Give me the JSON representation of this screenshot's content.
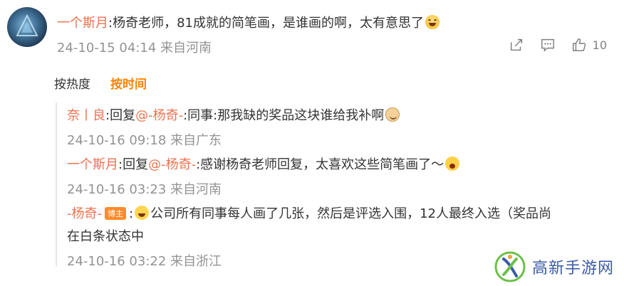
{
  "comment": {
    "username": "一个斯月",
    "text": ":杨奇老师，81成就的简笔画，是谁画的啊，太有意思了",
    "time": "24-10-15 04:14",
    "location": "来自河南",
    "like_count": "10",
    "icons": [
      "share-icon",
      "reply-icon",
      "like-icon"
    ]
  },
  "sort": {
    "hot": "按热度",
    "time": "按时间"
  },
  "replies": [
    {
      "username": "奈丨良",
      "reply_word": ":回复",
      "mention": "@-杨奇-",
      "text": ":同事:那我缺的奖品这块谁给我补啊",
      "time": "24-10-16 09:18",
      "location": "来自广东"
    },
    {
      "username": "一个斯月",
      "reply_word": ":回复",
      "mention": "@-杨奇-",
      "text": ":感谢杨奇老师回复，太喜欢这些简笔画了～",
      "time": "24-10-16 03:23",
      "location": "来自河南"
    },
    {
      "username": "-杨奇-",
      "badge": "博主",
      "text_line1": "公司所有同事每人画了几张，然后是评选入围，12人最终入选（奖品尚",
      "text_line2": "在白条状态中",
      "time": "24-10-16 03:22",
      "location": "来自浙江"
    }
  ],
  "watermark": {
    "text": "高新手游网"
  },
  "colors": {
    "username": "#eb7350",
    "accent": "#ff8200",
    "meta": "#939393",
    "watermark": "#3b5aa8"
  }
}
